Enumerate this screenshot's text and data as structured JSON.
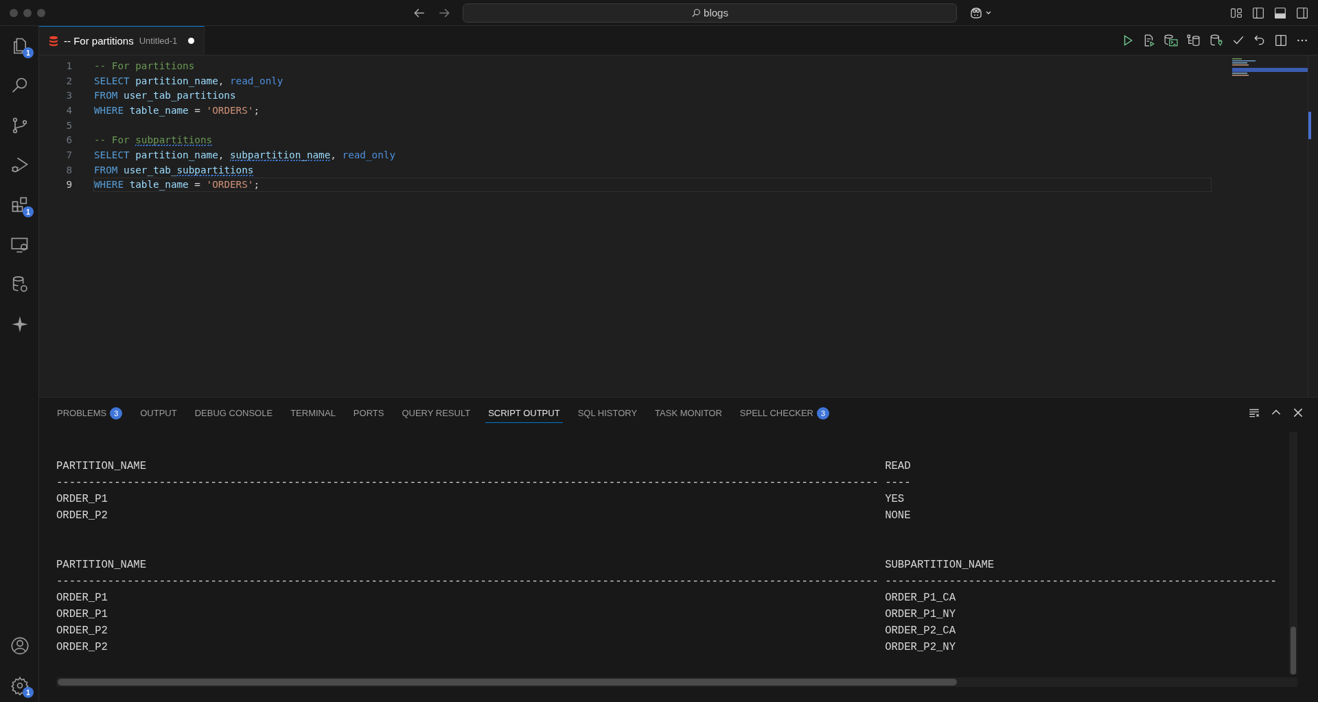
{
  "window": {
    "search": "blogs"
  },
  "activity_bar": {
    "top": [
      {
        "kind": "files",
        "badge": "1",
        "selected": false
      },
      {
        "kind": "search",
        "selected": false
      },
      {
        "kind": "source-control",
        "selected": false
      },
      {
        "kind": "run-debug",
        "selected": false
      },
      {
        "kind": "extensions",
        "badge": "1",
        "selected": false
      },
      {
        "kind": "remote",
        "selected": false
      },
      {
        "kind": "database",
        "selected": false
      },
      {
        "kind": "sparkle",
        "selected": false
      }
    ],
    "bottom": [
      {
        "kind": "account"
      },
      {
        "kind": "settings",
        "badge": "1"
      }
    ]
  },
  "editor_tabs": [
    {
      "title": "-- For partitions",
      "description": "Untitled-1",
      "dirty": true,
      "selected": true
    }
  ],
  "editor": {
    "lines": [
      {
        "number": "1",
        "current": false,
        "tokens": [
          {
            "text": "-- For partitions",
            "kind": "comment"
          }
        ]
      },
      {
        "number": "2",
        "current": false,
        "tokens": [
          {
            "text": "SELECT",
            "kind": "keyword"
          },
          {
            "text": " partition_name",
            "kind": "identifier"
          },
          {
            "text": ", ",
            "kind": "punct"
          },
          {
            "text": "read_only",
            "kind": "builtin"
          }
        ]
      },
      {
        "number": "3",
        "current": false,
        "tokens": [
          {
            "text": "FROM",
            "kind": "keyword"
          },
          {
            "text": " user_tab_partitions",
            "kind": "identifier"
          }
        ]
      },
      {
        "number": "4",
        "current": false,
        "tokens": [
          {
            "text": "WHERE",
            "kind": "keyword"
          },
          {
            "text": " table_name",
            "kind": "identifier"
          },
          {
            "text": " = ",
            "kind": "punct"
          },
          {
            "text": "'ORDERS'",
            "kind": "string"
          },
          {
            "text": ";",
            "kind": "punct"
          }
        ]
      },
      {
        "number": "5",
        "current": false
      },
      {
        "number": "6",
        "current": false,
        "tokens": [
          {
            "text": "-- For ",
            "kind": "comment"
          },
          {
            "text": "subpartitions",
            "kind": "comment",
            "squiggle": true
          }
        ]
      },
      {
        "number": "7",
        "current": false,
        "tokens": [
          {
            "text": "SELECT",
            "kind": "keyword"
          },
          {
            "text": " partition_name",
            "kind": "identifier"
          },
          {
            "text": ", ",
            "kind": "punct"
          },
          {
            "text": "subpartition_name",
            "kind": "identifier",
            "squiggle": true
          },
          {
            "text": ", ",
            "kind": "punct"
          },
          {
            "text": "read_only",
            "kind": "builtin"
          }
        ]
      },
      {
        "number": "8",
        "current": false,
        "tokens": [
          {
            "text": "FROM",
            "kind": "keyword"
          },
          {
            "text": " user_tab_",
            "kind": "identifier"
          },
          {
            "text": "subpartitions",
            "kind": "identifier",
            "squiggle": true
          }
        ]
      },
      {
        "number": "9",
        "current": true,
        "tokens": [
          {
            "text": "WHERE",
            "kind": "keyword"
          },
          {
            "text": " table_name",
            "kind": "identifier"
          },
          {
            "text": " = ",
            "kind": "punct"
          },
          {
            "text": "'ORDERS'",
            "kind": "string"
          },
          {
            "text": ";",
            "kind": "punct"
          }
        ]
      }
    ]
  },
  "panel": {
    "tabs": [
      {
        "label": "PROBLEMS",
        "badge": "3",
        "selected": false
      },
      {
        "label": "OUTPUT",
        "selected": false
      },
      {
        "label": "DEBUG CONSOLE",
        "selected": false
      },
      {
        "label": "TERMINAL",
        "selected": false
      },
      {
        "label": "PORTS",
        "selected": false
      },
      {
        "label": "QUERY RESULT",
        "selected": false
      },
      {
        "label": "SCRIPT OUTPUT",
        "selected": true
      },
      {
        "label": "SQL HISTORY",
        "selected": false
      },
      {
        "label": "TASK MONITOR",
        "selected": false
      },
      {
        "label": "SPELL CHECKER",
        "badge": "3",
        "selected": false
      }
    ],
    "script_output": [
      {
        "columns": [
          {
            "heading": "PARTITION_NAME",
            "underline": "--------------------------------------------------------------------------------------------------------------------------------"
          },
          {
            "heading": "READ",
            "underline": "----"
          }
        ],
        "rows": [
          [
            "ORDER_P1",
            "YES"
          ],
          [
            "ORDER_P2",
            "NONE"
          ]
        ]
      },
      {
        "columns": [
          {
            "heading": "PARTITION_NAME",
            "underline": "--------------------------------------------------------------------------------------------------------------------------------"
          },
          {
            "heading": "SUBPARTITION_NAME",
            "underline": "-------------------------------------------------------------"
          }
        ],
        "rows": [
          [
            "ORDER_P1",
            "ORDER_P1_CA"
          ],
          [
            "ORDER_P1",
            "ORDER_P1_NY"
          ],
          [
            "ORDER_P2",
            "ORDER_P2_CA"
          ],
          [
            "ORDER_P2",
            "ORDER_P2_NY"
          ]
        ]
      }
    ]
  }
}
